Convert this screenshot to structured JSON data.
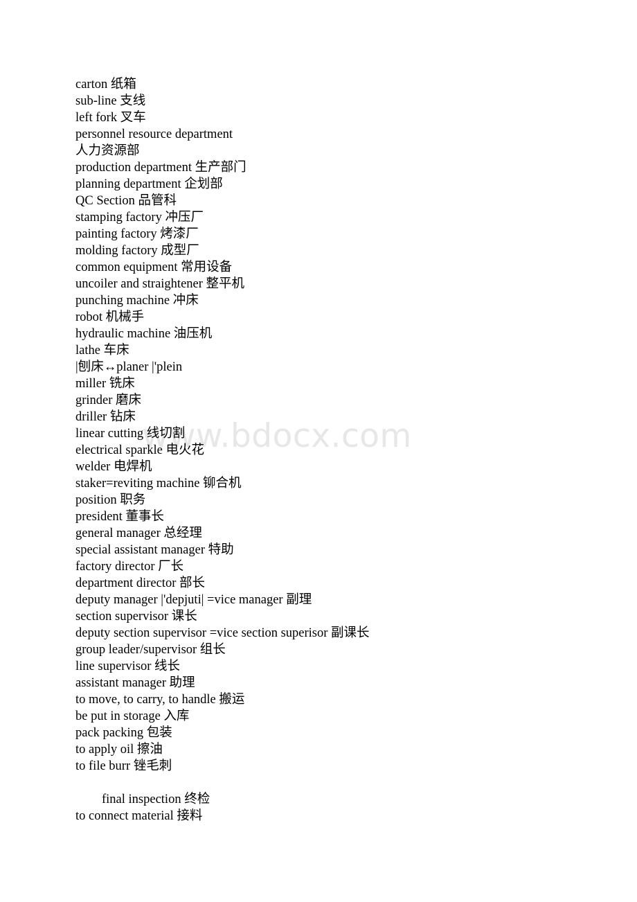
{
  "document": {
    "watermark": "www.bdocx.com",
    "lines": [
      {
        "text": "carton 纸箱",
        "indent": false
      },
      {
        "text": "sub-line 支线",
        "indent": false
      },
      {
        "text": "left fork 叉车",
        "indent": false
      },
      {
        "text": "personnel resource department",
        "indent": false
      },
      {
        "text": "人力资源部",
        "indent": false
      },
      {
        "text": "production department 生产部门",
        "indent": false
      },
      {
        "text": "planning department 企划部",
        "indent": false
      },
      {
        "text": "QC Section 品管科",
        "indent": false
      },
      {
        "text": "stamping factory 冲压厂",
        "indent": false
      },
      {
        "text": "painting factory 烤漆厂",
        "indent": false
      },
      {
        "text": "molding factory 成型厂",
        "indent": false
      },
      {
        "text": "common equipment 常用设备",
        "indent": false
      },
      {
        "text": "uncoiler and straightener 整平机",
        "indent": false
      },
      {
        "text": "punching machine 冲床",
        "indent": false
      },
      {
        "text": "robot 机械手",
        "indent": false
      },
      {
        "text": "hydraulic machine 油压机",
        "indent": false
      },
      {
        "text": "lathe 车床",
        "indent": false
      },
      {
        "text": "|刨床↔planer |'plein",
        "indent": false
      },
      {
        "text": "miller 铣床",
        "indent": false
      },
      {
        "text": "grinder 磨床",
        "indent": false
      },
      {
        "text": "driller 钻床",
        "indent": false
      },
      {
        "text": "linear cutting 线切割",
        "indent": false
      },
      {
        "text": "electrical sparkle 电火花",
        "indent": false
      },
      {
        "text": "welder 电焊机",
        "indent": false
      },
      {
        "text": "staker=reviting machine 铆合机",
        "indent": false
      },
      {
        "text": "position 职务",
        "indent": false
      },
      {
        "text": "president 董事长",
        "indent": false
      },
      {
        "text": "general manager 总经理",
        "indent": false
      },
      {
        "text": "special assistant manager 特助",
        "indent": false
      },
      {
        "text": "factory director 厂长",
        "indent": false
      },
      {
        "text": "department director 部长",
        "indent": false
      },
      {
        "text": "deputy manager |'depjuti| =vice manager 副理",
        "indent": false
      },
      {
        "text": "section supervisor 课长",
        "indent": false
      },
      {
        "text": "deputy section supervisor =vice section superisor 副课长",
        "indent": false
      },
      {
        "text": "group leader/supervisor 组长",
        "indent": false
      },
      {
        "text": "line supervisor 线长",
        "indent": false
      },
      {
        "text": "assistant manager 助理",
        "indent": false
      },
      {
        "text": "to move, to carry, to handle 搬运",
        "indent": false
      },
      {
        "text": "be put in storage 入库",
        "indent": false
      },
      {
        "text": "pack packing 包装",
        "indent": false
      },
      {
        "text": "to apply oil 擦油",
        "indent": false
      },
      {
        "text": "to file burr 锉毛刺",
        "indent": false
      },
      {
        "text": "",
        "indent": false
      },
      {
        "text": "final inspection 终检",
        "indent": true
      },
      {
        "text": "to connect material 接料",
        "indent": false
      }
    ]
  }
}
